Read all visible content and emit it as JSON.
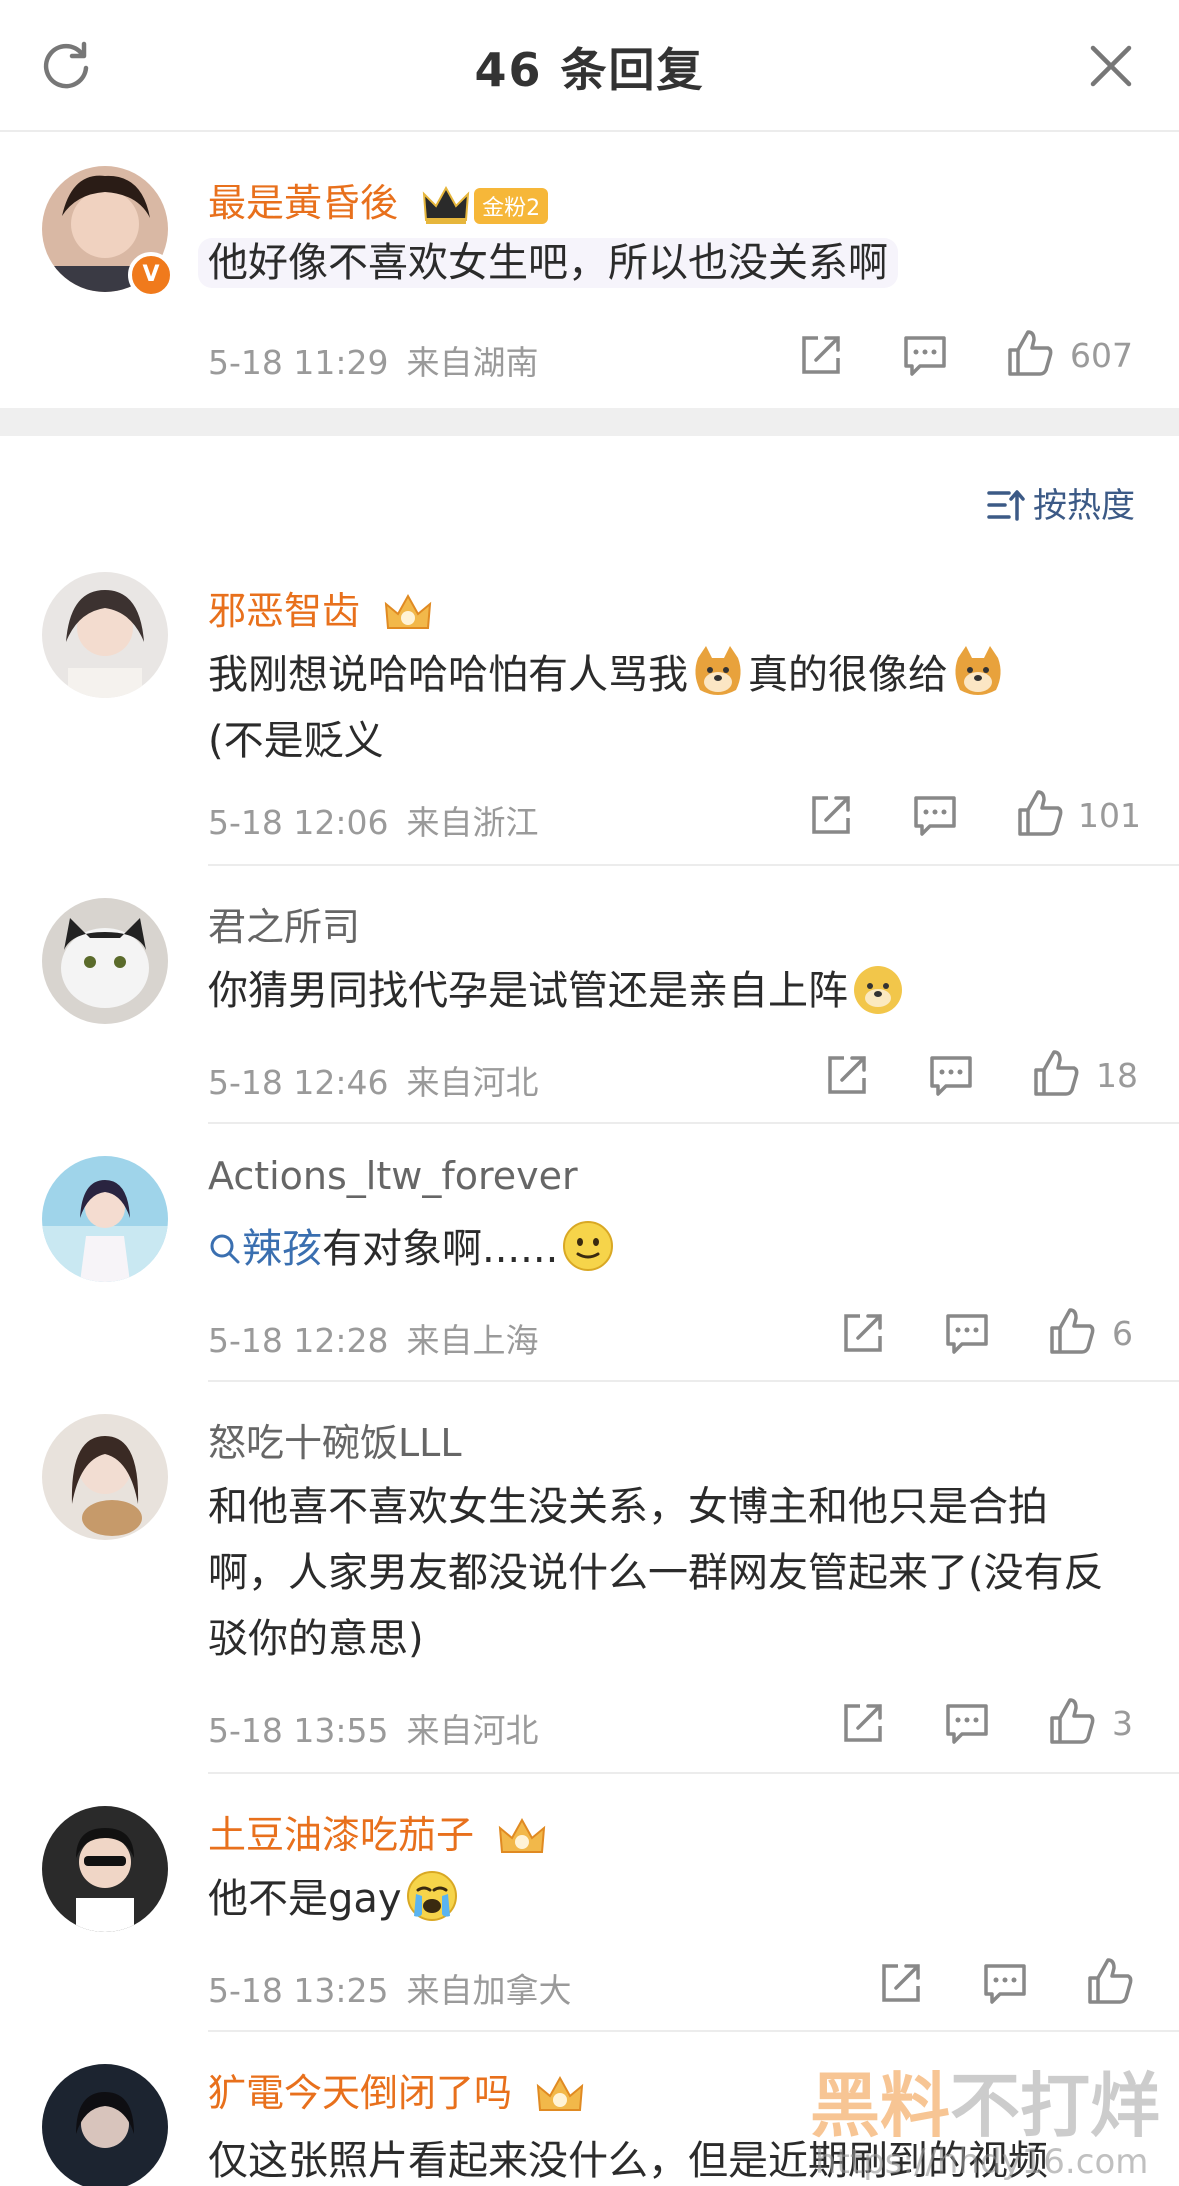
{
  "header": {
    "title": "46 条回复",
    "refresh_icon": "refresh-icon",
    "close_icon": "close-icon"
  },
  "original_comment": {
    "username": "最是黃昏後",
    "fan_badge": "金粉2",
    "text": "他好像不喜欢女生吧，所以也没关系啊",
    "date": "5-18 11:29",
    "location": "来自湖南",
    "likes": "607"
  },
  "sort": {
    "label": "按热度"
  },
  "replies": [
    {
      "username": "邪恶智齿",
      "text_a": "我刚想说哈哈哈怕有人骂我",
      "text_b": "真的很像给",
      "text_c": "(不是贬义",
      "date": "5-18 12:06",
      "location": "来自浙江",
      "likes": "101"
    },
    {
      "username": "君之所司",
      "text": "你猜男同找代孕是试管还是亲自上阵",
      "date": "5-18 12:46",
      "location": "来自河北",
      "likes": "18"
    },
    {
      "username": "Actions_ltw_forever",
      "link": "辣孩",
      "text": "有对象啊......",
      "date": "5-18 12:28",
      "location": "来自上海",
      "likes": "6"
    },
    {
      "username": "怒吃十碗饭LLL",
      "text": "和他喜不喜欢女生没关系，女博主和他只是合拍啊，人家男友都没说什么一群网友管起来了(没有反驳你的意思)",
      "date": "5-18 13:55",
      "location": "来自河北",
      "likes": "3"
    },
    {
      "username": "土豆油漆吃茄子",
      "text": "他不是gay",
      "date": "5-18 13:25",
      "location": "来自加拿大",
      "likes": ""
    },
    {
      "username": "犷電今天倒闭了吗",
      "text": "仅这张照片看起来没什么，但是近期刷到的视频"
    }
  ],
  "watermark": {
    "brand_a": "黑料",
    "brand_b": "不打烊",
    "url": "https://hhdy16.com"
  },
  "colors": {
    "vip_name": "#e8701c",
    "link": "#3a6fb0",
    "meta": "#9a9a9a"
  }
}
